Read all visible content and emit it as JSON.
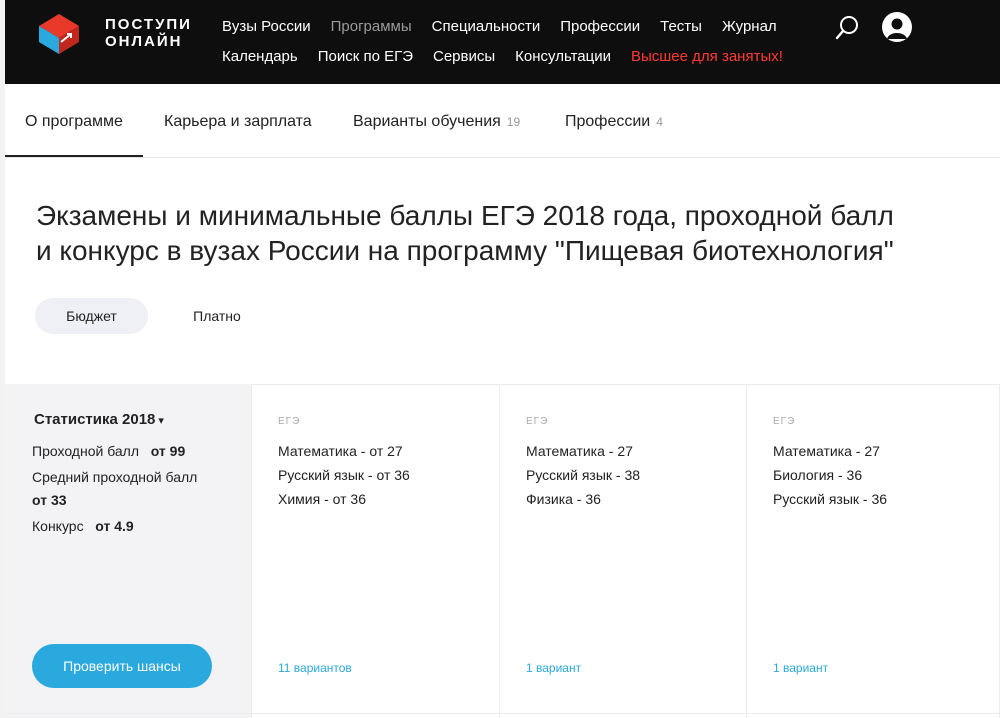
{
  "header": {
    "logo_line1": "ПОСТУПИ",
    "logo_line2": "ОНЛАЙН",
    "nav_row1": [
      "Вузы России",
      "Программы",
      "Специальности",
      "Профессии",
      "Тесты",
      "Журнал"
    ],
    "nav_row2": [
      "Календарь",
      "Поиск по ЕГЭ",
      "Сервисы",
      "Консультации",
      "Высшее для занятых!"
    ],
    "search_icon": "search-icon",
    "user_icon": "user-icon"
  },
  "tabs": [
    {
      "label": "О программе",
      "count": ""
    },
    {
      "label": "Карьера и зарплата",
      "count": ""
    },
    {
      "label": "Варианты обучения",
      "count": "19"
    },
    {
      "label": "Профессии",
      "count": "4"
    }
  ],
  "title_line1": "Экзамены и минимальные баллы ЕГЭ 2018 года, проходной балл",
  "title_line2": "и конкурс в вузах России на программу \"Пищевая биотехнология\"",
  "funding": {
    "budget": "Бюджет",
    "paid": "Платно"
  },
  "stats": {
    "heading": "Статистика 2018",
    "caret": "▾",
    "pass_label": "Проходной балл",
    "pass_value": "от 99",
    "avg_label": "Средний проходной балл",
    "avg_value": "от 33",
    "competition_label": "Конкурс",
    "competition_value": "от 4.9",
    "check_button": "Проверить шансы"
  },
  "cards": [
    {
      "label": "ЕГЭ",
      "subjects": [
        "Математика - от 27",
        "Русский язык - от 36",
        "Химия - от 36"
      ],
      "variants": "11 вариантов"
    },
    {
      "label": "ЕГЭ",
      "subjects": [
        "Математика - 27",
        "Русский язык - 38",
        "Физика - 36"
      ],
      "variants": "1 вариант"
    },
    {
      "label": "ЕГЭ",
      "subjects": [
        "Математика - 27",
        "Биология - 36",
        "Русский язык - 36"
      ],
      "variants": "1 вариант"
    }
  ],
  "colors": {
    "header_bg": "#0e0e0e",
    "accent_red": "#ff3b30",
    "accent_blue": "#2aa9df",
    "logo_red": "#e8392b",
    "logo_blue": "#2aa9df"
  }
}
